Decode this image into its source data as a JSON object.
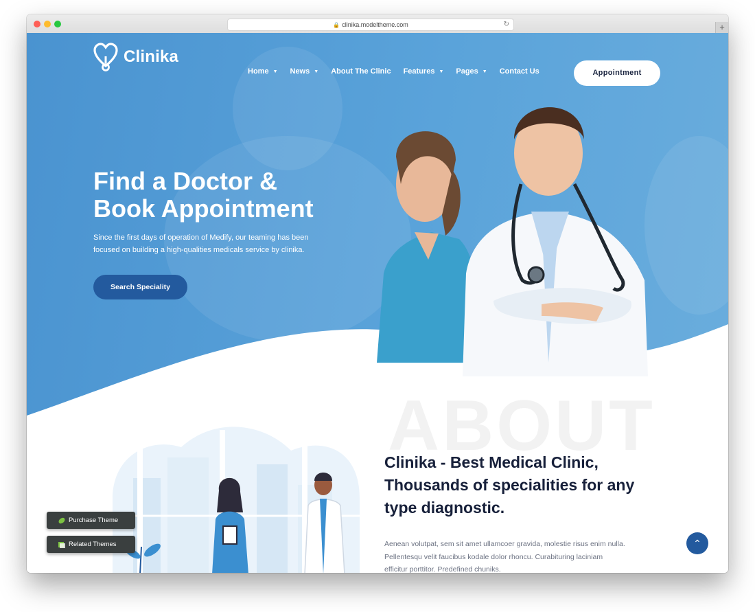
{
  "browser": {
    "url": "clinika.modeltheme.com"
  },
  "brand": {
    "name": "Clinika"
  },
  "nav": {
    "items": [
      {
        "label": "Home",
        "has_dropdown": true
      },
      {
        "label": "News",
        "has_dropdown": true
      },
      {
        "label": "About The Clinic",
        "has_dropdown": false
      },
      {
        "label": "Features",
        "has_dropdown": true
      },
      {
        "label": "Pages",
        "has_dropdown": true
      },
      {
        "label": "Contact Us",
        "has_dropdown": false
      }
    ],
    "cta_label": "Appointment"
  },
  "hero": {
    "title_line1": "Find a Doctor &",
    "title_line2": "Book Appointment",
    "subtitle_line1": "Since the first days of operation of Medify, our teaming has been",
    "subtitle_line2": "focused on building a high-qualities medicals service by clinika.",
    "button_label": "Search Speciality"
  },
  "about": {
    "background_word": "ABOUT",
    "title_line1": "Clinika - Best Medical Clinic,",
    "title_line2": "Thousands of specialities for any",
    "title_line3": "type diagnostic.",
    "text_line1": "Aenean volutpat, sem sit amet ullamcoer gravida, molestie risus enim nulla.",
    "text_line2": "Pellentesqu velit faucibus kodale dolor rhoncu. Curabituring laciniam",
    "text_line3": "efficitur porttitor. Predefined chuniks."
  },
  "floating": {
    "purchase_label": "Purchase Theme",
    "related_label": "Related Themes"
  },
  "colors": {
    "hero_blue": "#4a93d0",
    "accent_dark_blue": "#235a9e",
    "heading_dark": "#17203a"
  }
}
